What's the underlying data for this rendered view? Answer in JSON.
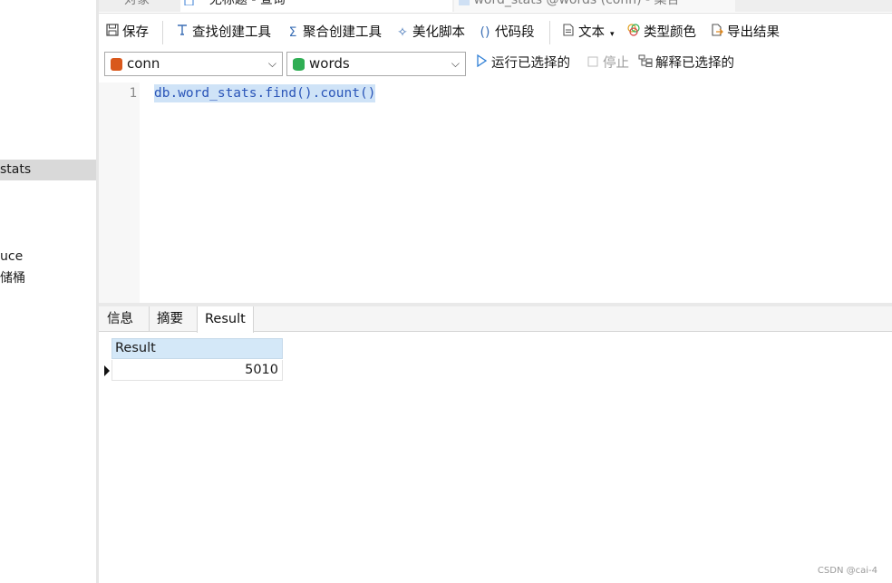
{
  "tabs": [
    {
      "label": "对象",
      "active": false
    },
    {
      "label": "* 无标题 - 查询",
      "active": true
    },
    {
      "label": "word_stats @words (conn) - 集合",
      "active": false
    }
  ],
  "navigator": {
    "items": [
      {
        "label": "stats",
        "selected": true
      },
      {
        "label": "uce",
        "selected": false
      },
      {
        "label": "储桶",
        "selected": false
      }
    ]
  },
  "toolbar": {
    "save": "保存",
    "find_builder": "查找创建工具",
    "aggregate_builder": "聚合创建工具",
    "beautify": "美化脚本",
    "snippet": "代码段",
    "text": "文本",
    "type_color": "类型颜色",
    "export": "导出结果"
  },
  "toolbar2": {
    "connection": "conn",
    "database": "words",
    "run_selected": "运行已选择的",
    "stop": "停止",
    "explain_selected": "解释已选择的"
  },
  "editor": {
    "line_number": "1",
    "code": "db.word_stats.find().count()"
  },
  "result_tabs": [
    "信息",
    "摘要",
    "Result"
  ],
  "result_grid": {
    "column": "Result",
    "rows": [
      "5010"
    ]
  },
  "watermark": "CSDN @cai-4",
  "colors": {
    "mongo_icon": "#d9581c",
    "db_icon": "#2fae54",
    "code_text": "#2a55b8",
    "selection": "#cfe3f7",
    "grid_header": "#d4e8f8"
  }
}
